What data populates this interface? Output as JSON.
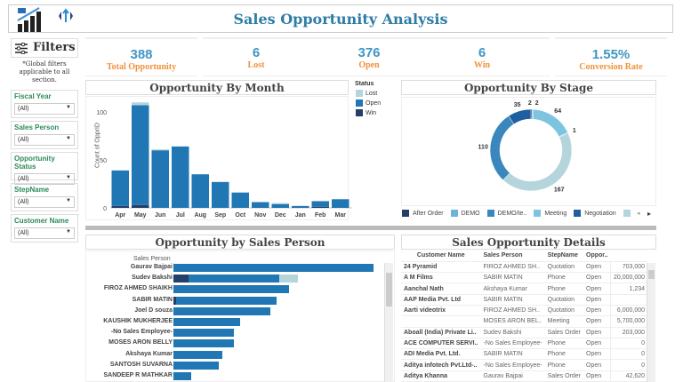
{
  "header": {
    "title": "Sales Opportunity Analysis",
    "logo_icon": "growth-chart-icon",
    "nav_icon": "swap-arrows-icon"
  },
  "kpis": [
    {
      "value": "388",
      "label": "Total Opportunity"
    },
    {
      "value": "6",
      "label": "Lost"
    },
    {
      "value": "376",
      "label": "Open"
    },
    {
      "value": "6",
      "label": "Win"
    },
    {
      "value": "1.55%",
      "label": "Conversion Rate"
    }
  ],
  "filters": {
    "title": "Filters",
    "note": "*Global filters applicable to all section.",
    "items": [
      {
        "label": "Fiscal Year",
        "value": "(All)"
      },
      {
        "label": "Sales Person",
        "value": "(All)"
      },
      {
        "label": "Opportunity Status",
        "value": "(All)"
      },
      {
        "label": "StepName",
        "value": "(All)"
      },
      {
        "label": "Customer Name",
        "value": "(All)"
      }
    ]
  },
  "colors": {
    "lost": "#b5d5dc",
    "open": "#2176b4",
    "win": "#253f6b",
    "title": "#2e7da6",
    "kpi_value": "#3f97c4",
    "kpi_label": "#f0913c"
  },
  "chart_data": [
    {
      "type": "bar",
      "title": "Opportunity By Month",
      "ylabel": "Count of OpprID",
      "ylim": [
        0,
        115
      ],
      "yticks": [
        "0",
        "50",
        "100"
      ],
      "categories": [
        "Apr",
        "May",
        "Jun",
        "Jul",
        "Aug",
        "Sep",
        "Oct",
        "Nov",
        "Dec",
        "Jan",
        "Feb",
        "Mar"
      ],
      "stacked": true,
      "legend_title": "Status",
      "legend_position": "right",
      "series": [
        {
          "name": "Win",
          "values": [
            2,
            3,
            0,
            0,
            0,
            0,
            0,
            0,
            0,
            0,
            1,
            0
          ]
        },
        {
          "name": "Open",
          "values": [
            37,
            104,
            60,
            64,
            35,
            27,
            16,
            6,
            4,
            2,
            6,
            9
          ]
        },
        {
          "name": "Lost",
          "values": [
            0,
            3,
            1,
            0,
            0,
            0,
            0,
            0,
            1,
            0,
            0,
            0
          ]
        }
      ]
    },
    {
      "type": "pie",
      "title": "Opportunity By Stage",
      "donut": true,
      "segments": [
        {
          "value": 2,
          "color": "#253f6b"
        },
        {
          "value": 2,
          "color": "#6fb3dc"
        },
        {
          "value": 64,
          "color": "#7cc4e0"
        },
        {
          "value": 1,
          "color": "#3a87bd"
        },
        {
          "value": 167,
          "color": "#b5d5dc"
        },
        {
          "value": 110,
          "color": "#3a87bd"
        },
        {
          "value": 35,
          "color": "#1f5fa0"
        }
      ],
      "legend": [
        {
          "name": "After Order",
          "color": "#253f6b"
        },
        {
          "name": "DEMO",
          "color": "#6fb3dc"
        },
        {
          "name": "DEMO/te..",
          "color": "#3a87bd"
        },
        {
          "name": "Meeting",
          "color": "#7cc4e0"
        },
        {
          "name": "Negotiation",
          "color": "#1f5fa0"
        },
        {
          "name": "",
          "color": "#b5d5dc"
        }
      ]
    },
    {
      "type": "bar",
      "orientation": "horizontal",
      "title": "Opportunity by Sales Person",
      "ylabel": "Sales Person",
      "stacked": true,
      "categories": [
        "Gaurav Bajpai",
        "Sudev Bakshi",
        "FIROZ AHMED SHAIKH",
        "SABIR MATIN",
        "Joel D souza",
        "KAUSHIK MUKHERJEE",
        "-No Sales Employee-",
        "MOSES ARON BELLY",
        "Akshaya Kumar",
        "SANTOSH SUVARNA",
        "SANDEEP R MATHKAR"
      ],
      "series": [
        {
          "name": "Win",
          "values": [
            0,
            5,
            0,
            1,
            0,
            0,
            0,
            0,
            0,
            0,
            0
          ]
        },
        {
          "name": "Open",
          "values": [
            66,
            30,
            38,
            33,
            32,
            22,
            20,
            20,
            16,
            15,
            6
          ]
        },
        {
          "name": "Lost",
          "values": [
            0,
            6,
            0,
            0,
            0,
            0,
            0,
            0,
            0,
            0,
            0
          ]
        }
      ]
    }
  ],
  "details": {
    "title": "Sales Opportunity Details",
    "columns": [
      "Customer Name",
      "Sales Person",
      "StepName",
      "Oppor..",
      ""
    ],
    "rows": [
      [
        "24 Pyramid",
        "FIROZ AHMED SH..",
        "Quotation",
        "Open",
        "703,000"
      ],
      [
        "A M Films",
        "SABIR MATIN",
        "Phone",
        "Open",
        "20,000,000"
      ],
      [
        "Aanchal Nath",
        "Akshaya Kumar",
        "Phone",
        "Open",
        "1,234"
      ],
      [
        "AAP Media Pvt. Ltd",
        "SABIR MATIN",
        "Quotation",
        "Open",
        ""
      ],
      [
        "Aarti videotrix",
        "FIROZ AHMED SH..",
        "Quotation",
        "Open",
        "6,000,000"
      ],
      [
        "",
        "MOSES ARON BEL..",
        "Meeting",
        "Open",
        "5,700,000"
      ],
      [
        "Aboall (India) Private Li..",
        "Sudev Bakshi",
        "Sales Order",
        "Open",
        "203,000"
      ],
      [
        "ACE COMPUTER SERVI..",
        "-No Sales Employee-",
        "Phone",
        "Open",
        "0"
      ],
      [
        "ADI Media Pvt. Ltd.",
        "SABIR MATIN",
        "Phone",
        "Open",
        "0"
      ],
      [
        "Aditya infotech Pvt.Ltd-..",
        "-No Sales Employee-",
        "Phone",
        "Open",
        "0"
      ],
      [
        "Aditya Khanna",
        "Gaurav Bajpai",
        "Sales Order",
        "Open",
        "42,620"
      ]
    ]
  }
}
